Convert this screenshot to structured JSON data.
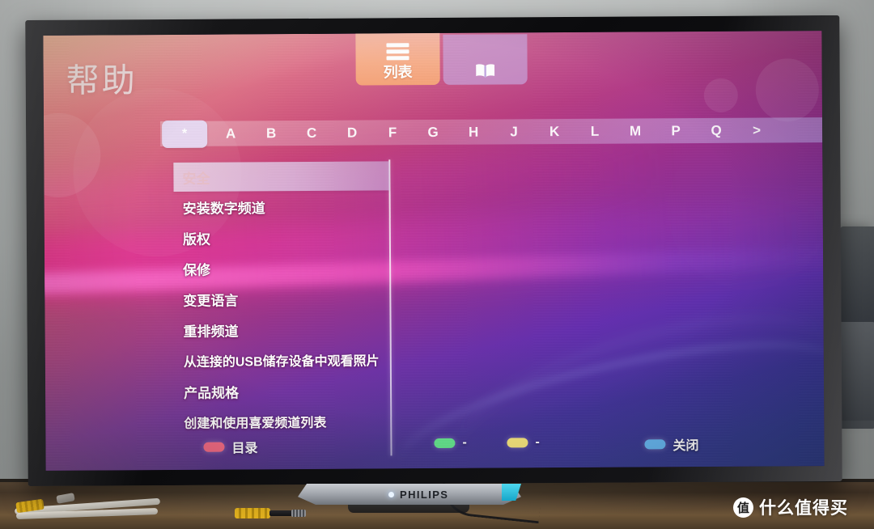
{
  "scene": {
    "device_brand": "PHILIPS",
    "watermark": {
      "badge": "值",
      "text": "什么值得买"
    }
  },
  "tv_ui": {
    "title": "帮助",
    "tabs": [
      {
        "icon": "hamburger-list-icon",
        "label": "列表",
        "active": true
      },
      {
        "icon": "open-book-icon",
        "label": "",
        "active": false
      }
    ],
    "alphabet_bar": {
      "selected": "*",
      "letters": [
        "A",
        "B",
        "C",
        "D",
        "F",
        "G",
        "H",
        "J",
        "K",
        "L",
        "M",
        "P",
        "Q",
        ">"
      ]
    },
    "menu": {
      "selected_index": 0,
      "items": [
        "安全",
        "安装数字频道",
        "版权",
        "保修",
        "变更语言",
        "重排频道",
        "从连接的USB储存设备中观看照片",
        "产品规格",
        "创建和使用喜爱频道列表"
      ]
    },
    "color_keys": [
      {
        "color": "#f56b84",
        "label": "目录"
      },
      {
        "color": "#62e08a",
        "label": "-"
      },
      {
        "color": "#f2e07a",
        "label": "-"
      },
      {
        "color": "#66b6f0",
        "label": "关闭"
      }
    ]
  }
}
